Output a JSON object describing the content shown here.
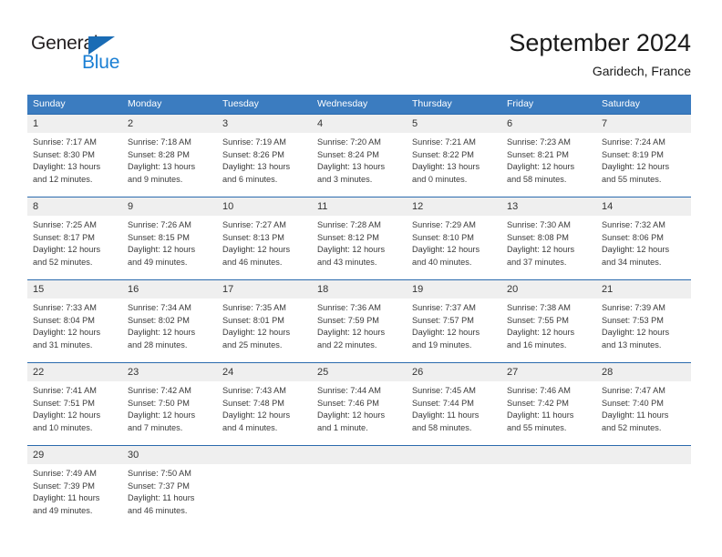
{
  "logo": {
    "word_one": "General",
    "word_two": "Blue",
    "triangle_color": "#1a6cb5",
    "blue_color": "#1a7fd4"
  },
  "header": {
    "month_title": "September 2024",
    "location": "Garidech, France"
  },
  "theme": {
    "header_blue": "#3b7cc0",
    "row_divider_blue": "#2a6aad",
    "daynum_band": "#efefef"
  },
  "calendar": {
    "weekdays": [
      "Sunday",
      "Monday",
      "Tuesday",
      "Wednesday",
      "Thursday",
      "Friday",
      "Saturday"
    ],
    "weeks": [
      [
        {
          "day": "1",
          "sunrise": "Sunrise: 7:17 AM",
          "sunset": "Sunset: 8:30 PM",
          "daylight_line1": "Daylight: 13 hours",
          "daylight_line2": "and 12 minutes."
        },
        {
          "day": "2",
          "sunrise": "Sunrise: 7:18 AM",
          "sunset": "Sunset: 8:28 PM",
          "daylight_line1": "Daylight: 13 hours",
          "daylight_line2": "and 9 minutes."
        },
        {
          "day": "3",
          "sunrise": "Sunrise: 7:19 AM",
          "sunset": "Sunset: 8:26 PM",
          "daylight_line1": "Daylight: 13 hours",
          "daylight_line2": "and 6 minutes."
        },
        {
          "day": "4",
          "sunrise": "Sunrise: 7:20 AM",
          "sunset": "Sunset: 8:24 PM",
          "daylight_line1": "Daylight: 13 hours",
          "daylight_line2": "and 3 minutes."
        },
        {
          "day": "5",
          "sunrise": "Sunrise: 7:21 AM",
          "sunset": "Sunset: 8:22 PM",
          "daylight_line1": "Daylight: 13 hours",
          "daylight_line2": "and 0 minutes."
        },
        {
          "day": "6",
          "sunrise": "Sunrise: 7:23 AM",
          "sunset": "Sunset: 8:21 PM",
          "daylight_line1": "Daylight: 12 hours",
          "daylight_line2": "and 58 minutes."
        },
        {
          "day": "7",
          "sunrise": "Sunrise: 7:24 AM",
          "sunset": "Sunset: 8:19 PM",
          "daylight_line1": "Daylight: 12 hours",
          "daylight_line2": "and 55 minutes."
        }
      ],
      [
        {
          "day": "8",
          "sunrise": "Sunrise: 7:25 AM",
          "sunset": "Sunset: 8:17 PM",
          "daylight_line1": "Daylight: 12 hours",
          "daylight_line2": "and 52 minutes."
        },
        {
          "day": "9",
          "sunrise": "Sunrise: 7:26 AM",
          "sunset": "Sunset: 8:15 PM",
          "daylight_line1": "Daylight: 12 hours",
          "daylight_line2": "and 49 minutes."
        },
        {
          "day": "10",
          "sunrise": "Sunrise: 7:27 AM",
          "sunset": "Sunset: 8:13 PM",
          "daylight_line1": "Daylight: 12 hours",
          "daylight_line2": "and 46 minutes."
        },
        {
          "day": "11",
          "sunrise": "Sunrise: 7:28 AM",
          "sunset": "Sunset: 8:12 PM",
          "daylight_line1": "Daylight: 12 hours",
          "daylight_line2": "and 43 minutes."
        },
        {
          "day": "12",
          "sunrise": "Sunrise: 7:29 AM",
          "sunset": "Sunset: 8:10 PM",
          "daylight_line1": "Daylight: 12 hours",
          "daylight_line2": "and 40 minutes."
        },
        {
          "day": "13",
          "sunrise": "Sunrise: 7:30 AM",
          "sunset": "Sunset: 8:08 PM",
          "daylight_line1": "Daylight: 12 hours",
          "daylight_line2": "and 37 minutes."
        },
        {
          "day": "14",
          "sunrise": "Sunrise: 7:32 AM",
          "sunset": "Sunset: 8:06 PM",
          "daylight_line1": "Daylight: 12 hours",
          "daylight_line2": "and 34 minutes."
        }
      ],
      [
        {
          "day": "15",
          "sunrise": "Sunrise: 7:33 AM",
          "sunset": "Sunset: 8:04 PM",
          "daylight_line1": "Daylight: 12 hours",
          "daylight_line2": "and 31 minutes."
        },
        {
          "day": "16",
          "sunrise": "Sunrise: 7:34 AM",
          "sunset": "Sunset: 8:02 PM",
          "daylight_line1": "Daylight: 12 hours",
          "daylight_line2": "and 28 minutes."
        },
        {
          "day": "17",
          "sunrise": "Sunrise: 7:35 AM",
          "sunset": "Sunset: 8:01 PM",
          "daylight_line1": "Daylight: 12 hours",
          "daylight_line2": "and 25 minutes."
        },
        {
          "day": "18",
          "sunrise": "Sunrise: 7:36 AM",
          "sunset": "Sunset: 7:59 PM",
          "daylight_line1": "Daylight: 12 hours",
          "daylight_line2": "and 22 minutes."
        },
        {
          "day": "19",
          "sunrise": "Sunrise: 7:37 AM",
          "sunset": "Sunset: 7:57 PM",
          "daylight_line1": "Daylight: 12 hours",
          "daylight_line2": "and 19 minutes."
        },
        {
          "day": "20",
          "sunrise": "Sunrise: 7:38 AM",
          "sunset": "Sunset: 7:55 PM",
          "daylight_line1": "Daylight: 12 hours",
          "daylight_line2": "and 16 minutes."
        },
        {
          "day": "21",
          "sunrise": "Sunrise: 7:39 AM",
          "sunset": "Sunset: 7:53 PM",
          "daylight_line1": "Daylight: 12 hours",
          "daylight_line2": "and 13 minutes."
        }
      ],
      [
        {
          "day": "22",
          "sunrise": "Sunrise: 7:41 AM",
          "sunset": "Sunset: 7:51 PM",
          "daylight_line1": "Daylight: 12 hours",
          "daylight_line2": "and 10 minutes."
        },
        {
          "day": "23",
          "sunrise": "Sunrise: 7:42 AM",
          "sunset": "Sunset: 7:50 PM",
          "daylight_line1": "Daylight: 12 hours",
          "daylight_line2": "and 7 minutes."
        },
        {
          "day": "24",
          "sunrise": "Sunrise: 7:43 AM",
          "sunset": "Sunset: 7:48 PM",
          "daylight_line1": "Daylight: 12 hours",
          "daylight_line2": "and 4 minutes."
        },
        {
          "day": "25",
          "sunrise": "Sunrise: 7:44 AM",
          "sunset": "Sunset: 7:46 PM",
          "daylight_line1": "Daylight: 12 hours",
          "daylight_line2": "and 1 minute."
        },
        {
          "day": "26",
          "sunrise": "Sunrise: 7:45 AM",
          "sunset": "Sunset: 7:44 PM",
          "daylight_line1": "Daylight: 11 hours",
          "daylight_line2": "and 58 minutes."
        },
        {
          "day": "27",
          "sunrise": "Sunrise: 7:46 AM",
          "sunset": "Sunset: 7:42 PM",
          "daylight_line1": "Daylight: 11 hours",
          "daylight_line2": "and 55 minutes."
        },
        {
          "day": "28",
          "sunrise": "Sunrise: 7:47 AM",
          "sunset": "Sunset: 7:40 PM",
          "daylight_line1": "Daylight: 11 hours",
          "daylight_line2": "and 52 minutes."
        }
      ],
      [
        {
          "day": "29",
          "sunrise": "Sunrise: 7:49 AM",
          "sunset": "Sunset: 7:39 PM",
          "daylight_line1": "Daylight: 11 hours",
          "daylight_line2": "and 49 minutes."
        },
        {
          "day": "30",
          "sunrise": "Sunrise: 7:50 AM",
          "sunset": "Sunset: 7:37 PM",
          "daylight_line1": "Daylight: 11 hours",
          "daylight_line2": "and 46 minutes."
        },
        {
          "day": "",
          "sunrise": "",
          "sunset": "",
          "daylight_line1": "",
          "daylight_line2": ""
        },
        {
          "day": "",
          "sunrise": "",
          "sunset": "",
          "daylight_line1": "",
          "daylight_line2": ""
        },
        {
          "day": "",
          "sunrise": "",
          "sunset": "",
          "daylight_line1": "",
          "daylight_line2": ""
        },
        {
          "day": "",
          "sunrise": "",
          "sunset": "",
          "daylight_line1": "",
          "daylight_line2": ""
        },
        {
          "day": "",
          "sunrise": "",
          "sunset": "",
          "daylight_line1": "",
          "daylight_line2": ""
        }
      ]
    ]
  }
}
